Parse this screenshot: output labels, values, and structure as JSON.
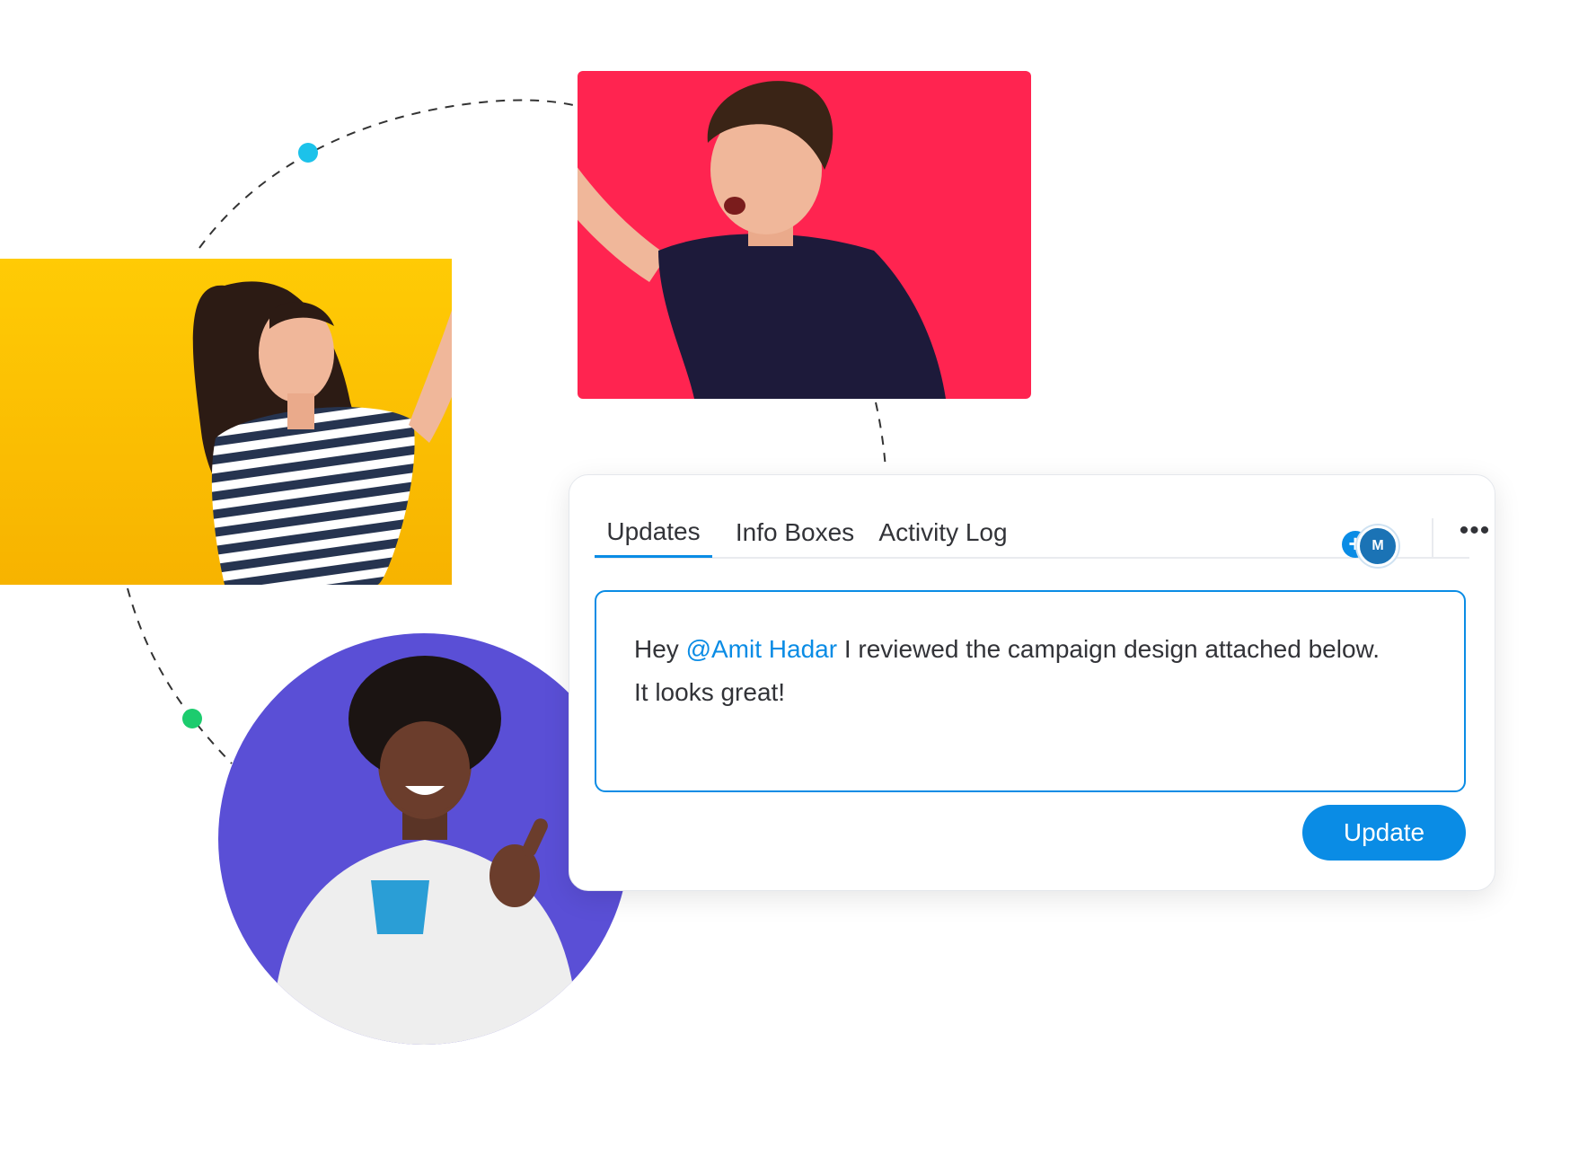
{
  "tabs": {
    "updates": "Updates",
    "info_boxes": "Info Boxes",
    "activity_log": "Activity Log",
    "active": "Updates"
  },
  "header": {
    "add_icon": "+",
    "avatar_initial": "M",
    "more_icon": "•••"
  },
  "editor": {
    "text_before": "Hey ",
    "mention": "@Amit Hadar",
    "text_after": " I reviewed the campaign design attached below.",
    "line2": "It looks great!"
  },
  "button": {
    "update_label": "Update"
  },
  "colors": {
    "accent": "#0a8ce5",
    "yellow_bg": "#ffc300",
    "red_bg": "#ff2450",
    "purple_bg": "#5a4fd6",
    "dot_blue": "#1cc2ea",
    "dot_green": "#1ccc6e"
  },
  "photos": {
    "woman": "photo-woman-striped-shirt",
    "man_red": "photo-man-high-five",
    "man_purple": "photo-man-coffee-thumbs-up"
  }
}
